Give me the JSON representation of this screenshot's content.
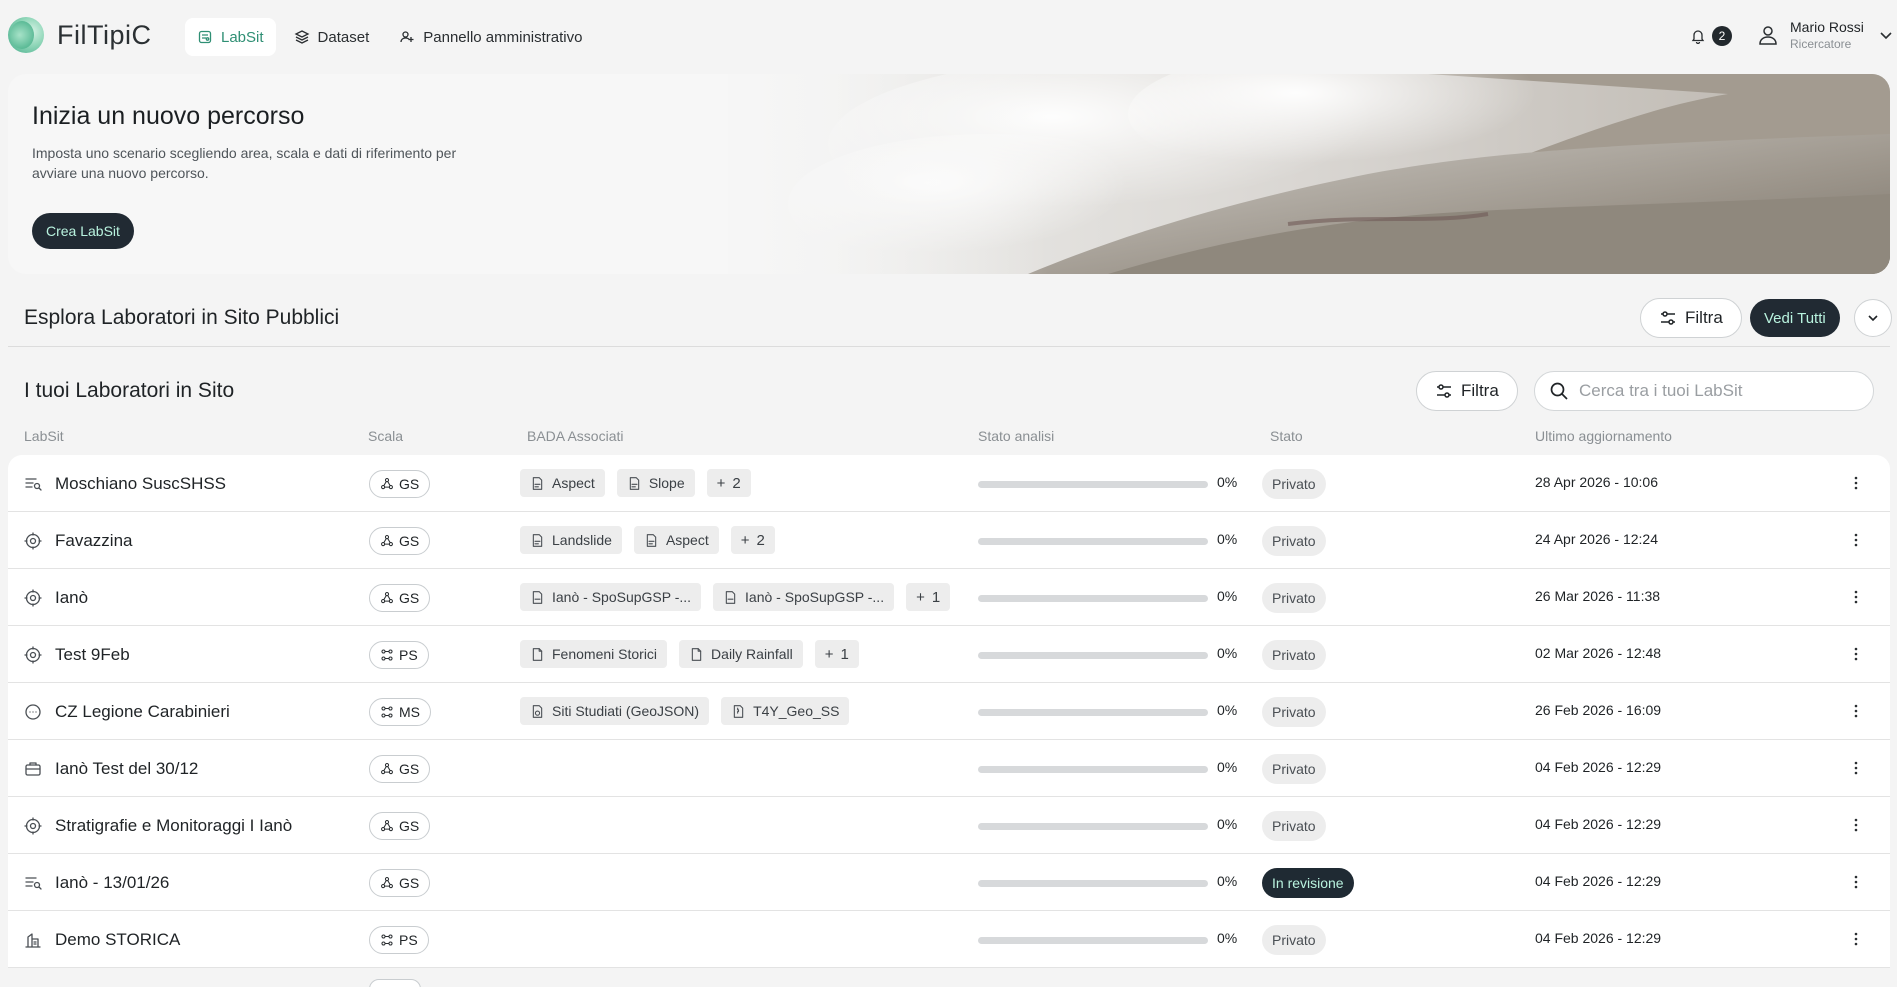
{
  "app": {
    "name": "FilTipiC"
  },
  "nav": {
    "items": [
      {
        "label": "LabSit",
        "icon": "labsit-icon",
        "active": true
      },
      {
        "label": "Dataset",
        "icon": "layers-icon",
        "active": false
      },
      {
        "label": "Pannello amministrativo",
        "icon": "admin-users-icon",
        "active": false
      }
    ]
  },
  "notifications": {
    "count": "2"
  },
  "user": {
    "name": "Mario Rossi",
    "role": "Ricercatore"
  },
  "hero": {
    "title": "Inizia un nuovo percorso",
    "description": "Imposta uno scenario scegliendo area, scala e dati di riferimento per avviare una nuovo percorso.",
    "cta_label": "Crea LabSit"
  },
  "public_section": {
    "title": "Esplora Laboratori in Sito Pubblici",
    "filter_label": "Filtra",
    "see_all_label": "Vedi Tutti"
  },
  "my_section": {
    "title": "I tuoi Laboratori in Sito",
    "filter_label": "Filtra",
    "search_placeholder": "Cerca tra i tuoi LabSit",
    "search_value": ""
  },
  "table": {
    "columns": [
      "LabSit",
      "Scala",
      "BADA Associati",
      "Stato analisi",
      "Stato",
      "Ultimo aggiornamento"
    ],
    "rows": [
      {
        "icon": "list-search-icon",
        "name": "Moschiano SuscSHSS",
        "scale": "GS",
        "scale_icon": "nodes-icon",
        "bada": [
          {
            "label": "Aspect",
            "icon": "tif-file-icon"
          },
          {
            "label": "Slope",
            "icon": "tif-file-icon"
          }
        ],
        "bada_more": "2",
        "progress": 0,
        "progress_label": "0%",
        "status": "Privato",
        "updated": "28 Apr 2026 - 10:06"
      },
      {
        "icon": "target-icon",
        "name": "Favazzina",
        "scale": "GS",
        "scale_icon": "nodes-icon",
        "bada": [
          {
            "label": "Landslide",
            "icon": "tif-file-icon"
          },
          {
            "label": "Aspect",
            "icon": "tif-file-icon"
          }
        ],
        "bada_more": "2",
        "progress": 0,
        "progress_label": "0%",
        "status": "Privato",
        "updated": "24 Apr 2026 - 12:24"
      },
      {
        "icon": "target-icon",
        "name": "Ianò",
        "scale": "GS",
        "scale_icon": "nodes-icon",
        "bada": [
          {
            "label": "Ianò - SpoSupGSP -...",
            "icon": "csv-file-icon"
          },
          {
            "label": "Ianò - SpoSupGSP -...",
            "icon": "csv-file-icon"
          }
        ],
        "bada_more": "1",
        "progress": 0,
        "progress_label": "0%",
        "status": "Privato",
        "updated": "26 Mar 2026 - 11:38"
      },
      {
        "icon": "target-icon",
        "name": "Test 9Feb",
        "scale": "PS",
        "scale_icon": "grid-nodes-icon",
        "bada": [
          {
            "label": "Fenomeni Storici",
            "icon": "file-icon"
          },
          {
            "label": "Daily Rainfall",
            "icon": "file-icon"
          }
        ],
        "bada_more": "1",
        "progress": 0,
        "progress_label": "0%",
        "status": "Privato",
        "updated": "02 Mar 2026 - 12:48"
      },
      {
        "icon": "chat-icon",
        "name": "CZ Legione Carabinieri",
        "scale": "MS",
        "scale_icon": "grid-nodes-icon",
        "bada": [
          {
            "label": "Siti Studiati (GeoJSON)",
            "icon": "geojson-file-icon"
          },
          {
            "label": "T4Y_Geo_SS",
            "icon": "zip-file-icon"
          }
        ],
        "bada_more": "",
        "progress": 0,
        "progress_label": "0%",
        "status": "Privato",
        "updated": "26 Feb 2026 - 16:09"
      },
      {
        "icon": "briefcase-icon",
        "name": "Ianò Test del 30/12",
        "scale": "GS",
        "scale_icon": "nodes-icon",
        "bada": [],
        "bada_more": "",
        "progress": 0,
        "progress_label": "0%",
        "status": "Privato",
        "updated": "04 Feb 2026 - 12:29"
      },
      {
        "icon": "target-icon",
        "name": "Stratigrafie e Monitoraggi I Ianò",
        "scale": "GS",
        "scale_icon": "nodes-icon",
        "bada": [],
        "bada_more": "",
        "progress": 0,
        "progress_label": "0%",
        "status": "Privato",
        "updated": "04 Feb 2026 - 12:29"
      },
      {
        "icon": "list-search-icon",
        "name": "Ianò - 13/01/26",
        "scale": "GS",
        "scale_icon": "nodes-icon",
        "bada": [],
        "bada_more": "",
        "progress": 0,
        "progress_label": "0%",
        "status": "In revisione",
        "status_variant": "review",
        "updated": "04 Feb 2026 - 12:29"
      },
      {
        "icon": "building-icon",
        "name": "Demo STORICA",
        "scale": "PS",
        "scale_icon": "grid-nodes-icon",
        "bada": [],
        "bada_more": "",
        "progress": 0,
        "progress_label": "0%",
        "status": "Privato",
        "updated": "04 Feb 2026 - 12:29"
      }
    ]
  },
  "colors": {
    "accent": "#3aa586",
    "dark": "#212a33",
    "dark_button_text": "#b9f3df"
  }
}
